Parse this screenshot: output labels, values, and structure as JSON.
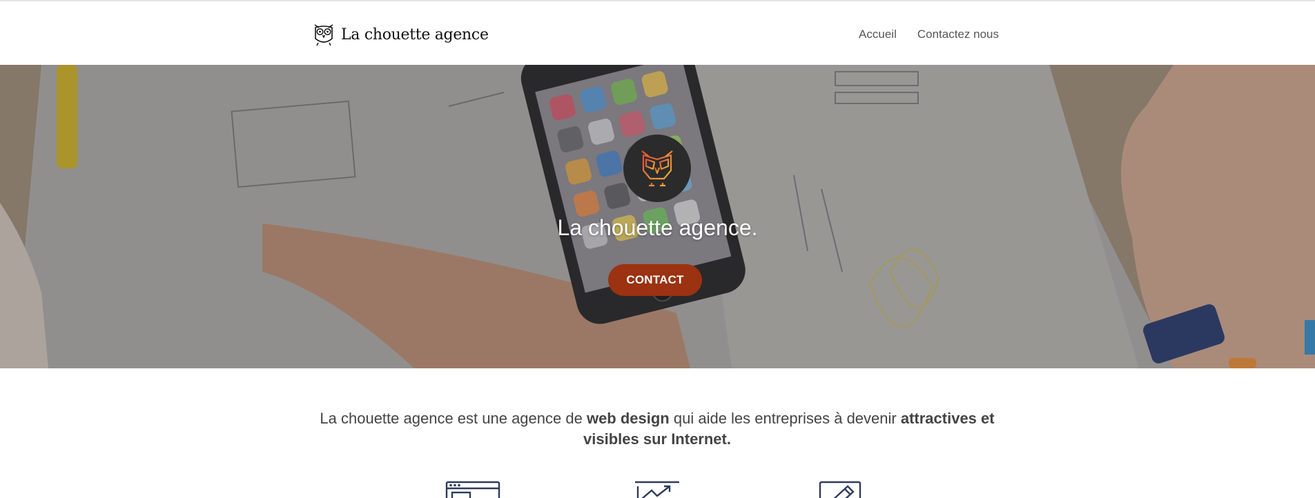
{
  "header": {
    "brand": "La chouette agence",
    "nav": [
      {
        "label": "Accueil"
      },
      {
        "label": "Contactez nous"
      }
    ]
  },
  "hero": {
    "title": "La chouette agence.",
    "cta_label": "CONTACT"
  },
  "intro": {
    "part1": "La chouette agence est une agence de ",
    "bold1": "web design",
    "part2": " qui aide les entreprises à devenir ",
    "bold2": "attractives et visibles sur Internet."
  },
  "features": [
    {
      "icon": "browser-window-icon"
    },
    {
      "icon": "growth-chart-icon"
    },
    {
      "icon": "edit-pencil-icon"
    }
  ],
  "colors": {
    "accent": "#9b3211",
    "badge": "#2b2b2b",
    "text": "#444444",
    "feature_icon": "#2e3a5c"
  }
}
